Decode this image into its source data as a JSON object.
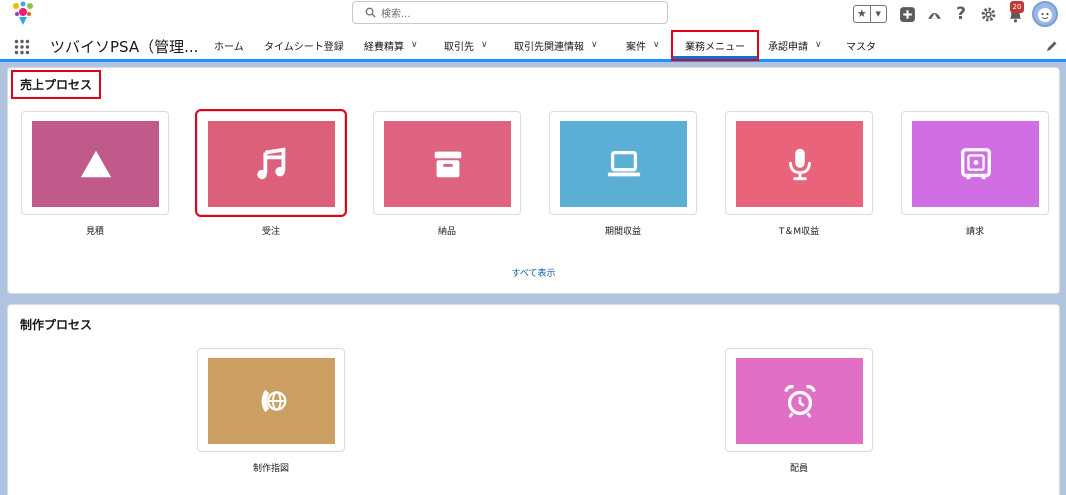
{
  "header": {
    "search_placeholder": "検索...",
    "notification_count": "20"
  },
  "nav": {
    "app_name": "ツバイソPSA（管理...",
    "items": [
      {
        "label": "ホーム"
      },
      {
        "label": "タイムシート登録"
      },
      {
        "label": "経費精算"
      },
      {
        "label": "取引先"
      },
      {
        "label": "取引先関連情報"
      },
      {
        "label": "案件"
      },
      {
        "label": "業務メニュー"
      },
      {
        "label": "承認申請"
      },
      {
        "label": "マスタ"
      }
    ]
  },
  "sales_process": {
    "title": "売上プロセス",
    "show_all": "すべて表示",
    "tiles": [
      {
        "label": "見積",
        "icon": "triangle-icon",
        "color": "#c05a8a"
      },
      {
        "label": "受注",
        "icon": "music-note-icon",
        "color": "#dc607a"
      },
      {
        "label": "納品",
        "icon": "archive-box-icon",
        "color": "#de6380"
      },
      {
        "label": "期間収益",
        "icon": "laptop-icon",
        "color": "#5bafd5"
      },
      {
        "label": "T＆M収益",
        "icon": "microphone-icon",
        "color": "#e9647b"
      },
      {
        "label": "請求",
        "icon": "safe-icon",
        "color": "#d06ee4"
      }
    ]
  },
  "production_process": {
    "title": "制作プロセス",
    "tiles": [
      {
        "label": "制作指図",
        "icon": "call-globe-icon",
        "color": "#cb9f61"
      },
      {
        "label": "配員",
        "icon": "alarm-clock-icon",
        "color": "#e16fc5"
      }
    ]
  }
}
